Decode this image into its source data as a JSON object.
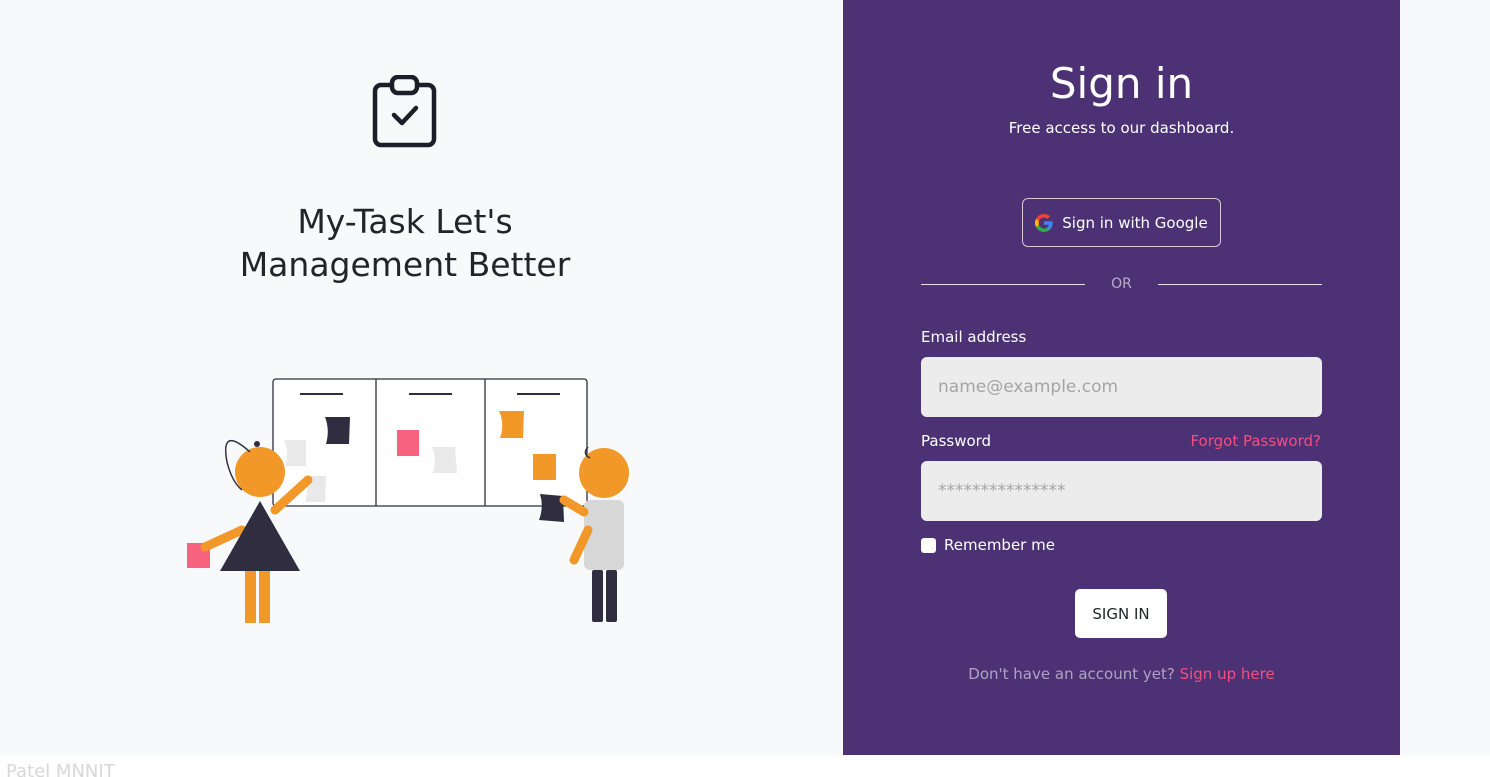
{
  "left": {
    "headline_line1": "My-Task Let's",
    "headline_line2": "Management Better",
    "logo_icon": "clipboard-check-icon"
  },
  "signin": {
    "title": "Sign in",
    "subtitle": "Free access to our dashboard.",
    "google_button_label": "Sign in with Google",
    "divider_text": "OR",
    "email_label": "Email address",
    "email_placeholder": "name@example.com",
    "email_value": "",
    "password_label": "Password",
    "forgot_password": "Forgot Password?",
    "password_placeholder": "***************",
    "password_value": "",
    "remember_label": "Remember me",
    "remember_checked": false,
    "submit_label": "SIGN IN",
    "signup_prompt": "Don't have an account yet?",
    "signup_link": "Sign up here"
  },
  "colors": {
    "panel": "#4c3274",
    "accent": "#f0507f",
    "orange": "#f19828",
    "dark": "#2f2d3f",
    "pink": "#f7637f"
  },
  "footer_fragments": [
    "Patel MNNIT"
  ]
}
